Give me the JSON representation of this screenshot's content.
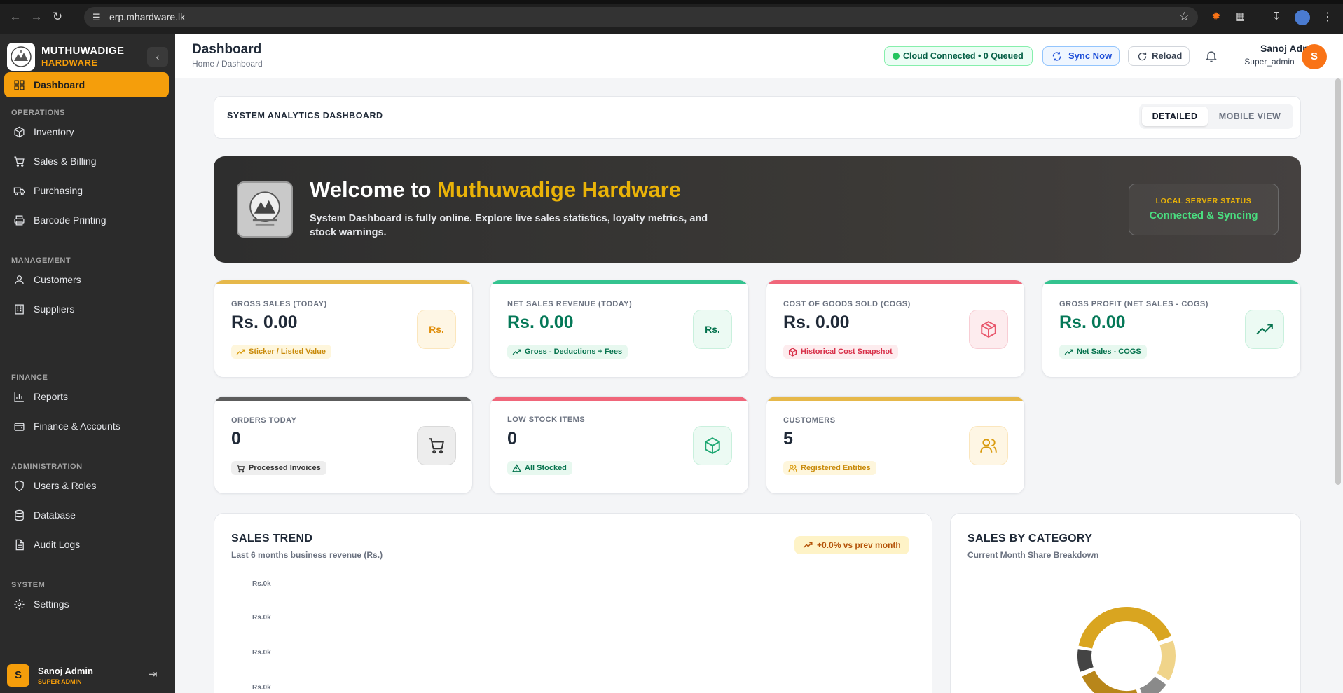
{
  "browser": {
    "url": "erp.mhardware.lk"
  },
  "sidebar": {
    "brand_name": "MUTHUWADIGE",
    "brand_sub": "HARDWARE",
    "items": [
      {
        "label": "Dashboard",
        "icon": "grid-icon",
        "active": true
      },
      {
        "section": "OPERATIONS"
      },
      {
        "label": "Inventory",
        "icon": "box-icon"
      },
      {
        "label": "Sales & Billing",
        "icon": "cart-icon"
      },
      {
        "label": "Purchasing",
        "icon": "truck-icon"
      },
      {
        "label": "Barcode Printing",
        "icon": "printer-icon"
      },
      {
        "section": "MANAGEMENT"
      },
      {
        "label": "Customers",
        "icon": "user-icon"
      },
      {
        "label": "Suppliers",
        "icon": "building-icon"
      },
      {
        "section": "FINANCE"
      },
      {
        "label": "Reports",
        "icon": "bar-chart-icon"
      },
      {
        "label": "Finance & Accounts",
        "icon": "wallet-icon"
      },
      {
        "section": "ADMINISTRATION"
      },
      {
        "label": "Users & Roles",
        "icon": "shield-icon"
      },
      {
        "label": "Database",
        "icon": "database-icon"
      },
      {
        "label": "Audit Logs",
        "icon": "file-icon"
      },
      {
        "section": "SYSTEM"
      },
      {
        "label": "Settings",
        "icon": "gear-icon"
      }
    ],
    "user": {
      "initial": "S",
      "name": "Sanoj Admin",
      "role": "SUPER ADMIN"
    }
  },
  "header": {
    "title": "Dashboard",
    "breadcrumb": "Home / Dashboard",
    "connection": "Cloud Connected • 0 Queued",
    "sync_label": "Sync Now",
    "reload_label": "Reload",
    "user_name": "Sanoj Admin",
    "user_role": "Super_admin",
    "user_initial": "S"
  },
  "analytics": {
    "title": "SYSTEM ANALYTICS DASHBOARD",
    "view_detailed": "DETAILED",
    "view_mobile": "MOBILE VIEW"
  },
  "welcome": {
    "heading_prefix": "Welcome to",
    "heading_accent": "Muthuwadige Hardware",
    "text": "System Dashboard is fully online. Explore live sales statistics, loyalty metrics, and stock warnings.",
    "status_label": "LOCAL SERVER STATUS",
    "status_value": "Connected & Syncing"
  },
  "kpis": [
    {
      "label": "GROSS SALES (TODAY)",
      "value": "Rs. 0.00",
      "tag": "Sticker / Listed Value",
      "icon_text": "Rs.",
      "color": "#e6b84a"
    },
    {
      "label": "NET SALES REVENUE (TODAY)",
      "value": "Rs. 0.00",
      "tag": "Gross - Deductions + Fees",
      "icon_text": "Rs.",
      "color": "#34c38f"
    },
    {
      "label": "COST OF GOODS SOLD (COGS)",
      "value": "Rs. 0.00",
      "tag": "Historical Cost Snapshot",
      "icon": "package-icon",
      "color": "#f0667a"
    },
    {
      "label": "GROSS PROFIT (NET SALES - COGS)",
      "value": "Rs. 0.00",
      "tag": "Net Sales - COGS",
      "icon": "trending-up-icon",
      "color": "#34c38f"
    },
    {
      "label": "ORDERS TODAY",
      "value": "0",
      "tag": "Processed Invoices",
      "icon": "cart-icon",
      "color": "#5c5c5c"
    },
    {
      "label": "LOW STOCK ITEMS",
      "value": "0",
      "tag": "All Stocked",
      "icon": "cube-icon",
      "color": "#f0667a"
    },
    {
      "label": "CUSTOMERS",
      "value": "5",
      "tag": "Registered Entities",
      "icon": "users-icon",
      "color": "#e6b84a"
    }
  ],
  "sales_trend": {
    "title": "SALES TREND",
    "subtitle": "Last 6 months business revenue (Rs.)",
    "change": "+0.0% vs prev month",
    "y_ticks": [
      "Rs.0k",
      "Rs.0k",
      "Rs.0k",
      "Rs.0k"
    ]
  },
  "sales_by_category": {
    "title": "SALES BY CATEGORY",
    "subtitle": "Current Month Share Breakdown",
    "segment_colors": [
      "#d9a520",
      "#f0d48a",
      "#8a8a8a",
      "#b8861a",
      "#444444"
    ]
  }
}
